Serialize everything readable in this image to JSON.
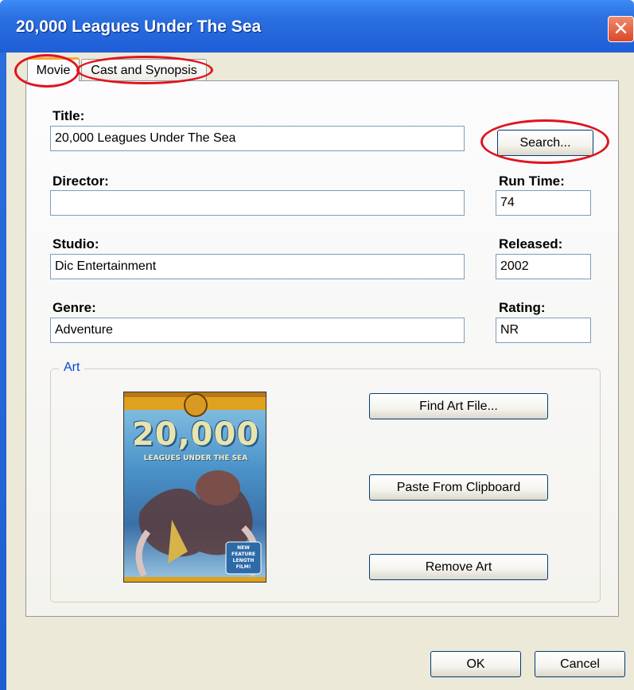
{
  "window": {
    "title": "20,000 Leagues Under The Sea",
    "close_glyph": "✕"
  },
  "tabs": [
    {
      "label": "Movie",
      "selected": true
    },
    {
      "label": "Cast and Synopsis",
      "selected": false
    }
  ],
  "form": {
    "title_label": "Title:",
    "title_value": "20,000 Leagues Under The Sea",
    "search_label": "Search...",
    "director_label": "Director:",
    "director_value": "",
    "runtime_label": "Run Time:",
    "runtime_value": "74",
    "studio_label": "Studio:",
    "studio_value": "Dic Entertainment",
    "released_label": "Released:",
    "released_value": "2002",
    "genre_label": "Genre:",
    "genre_value": "Adventure",
    "rating_label": "Rating:",
    "rating_value": "NR"
  },
  "art": {
    "group_label": "Art",
    "find_label": "Find Art File...",
    "paste_label": "Paste From Clipboard",
    "remove_label": "Remove Art",
    "poster_title": "20,000",
    "poster_subtitle": "LEAGUES UNDER THE SEA",
    "poster_badge": "NEW FEATURE LENGTH FILM!"
  },
  "footer": {
    "ok_label": "OK",
    "cancel_label": "Cancel"
  },
  "colors": {
    "titlebar": "#1f5ed6",
    "annotation": "#e0141e",
    "legend": "#0046d5"
  }
}
